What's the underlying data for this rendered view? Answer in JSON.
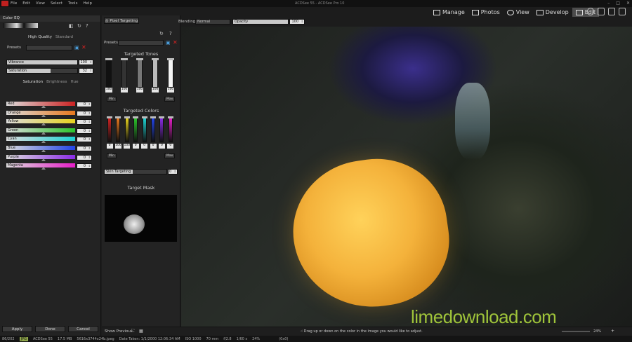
{
  "app": {
    "window_title": "ACDSee 55 - ACDSee Pro 10"
  },
  "menu": [
    "File",
    "Edit",
    "View",
    "Select",
    "Tools",
    "Help"
  ],
  "modes": [
    {
      "label": "Manage",
      "icon": "grid-icon"
    },
    {
      "label": "Photos",
      "icon": "photos-icon"
    },
    {
      "label": "View",
      "icon": "eye-icon"
    },
    {
      "label": "Develop",
      "icon": "develop-icon"
    },
    {
      "label": "Edit",
      "icon": "edit-icon",
      "active": true
    }
  ],
  "color_eq": {
    "title": "Color EQ",
    "quality_tabs": [
      "High Quality",
      "Standard"
    ],
    "presets_label": "Presets",
    "vibrance": {
      "label": "Vibrance",
      "value": "100",
      "fraction": 1.0
    },
    "saturation": {
      "label": "Saturation",
      "value": "32",
      "fraction": 0.62
    },
    "tabs": [
      "Saturation",
      "Brightness",
      "Hue"
    ],
    "colors": [
      {
        "label": "Red",
        "value": "0",
        "grad": "linear-gradient(90deg,#ddd,#c22)"
      },
      {
        "label": "Orange",
        "value": "0",
        "grad": "linear-gradient(90deg,#ddd,#e6781e)"
      },
      {
        "label": "Yellow",
        "value": "0",
        "grad": "linear-gradient(90deg,#ddd,#e6d21e)"
      },
      {
        "label": "Green",
        "value": "0",
        "grad": "linear-gradient(90deg,#ddd,#2bc32b)"
      },
      {
        "label": "Cyan",
        "value": "0",
        "grad": "linear-gradient(90deg,#ddd,#1ed2d2)"
      },
      {
        "label": "Blue",
        "value": "0",
        "grad": "linear-gradient(90deg,#ddd,#2244e6)"
      },
      {
        "label": "Purple",
        "value": "0",
        "grad": "linear-gradient(90deg,#ddd,#8a2be6)"
      },
      {
        "label": "Magenta",
        "value": "0",
        "grad": "linear-gradient(90deg,#ddd,#e61ec8)"
      }
    ],
    "apply_label": "Apply",
    "done_label": "Done",
    "cancel_label": "Cancel"
  },
  "pixel_targeting": {
    "button_label": "Pixel Targeting",
    "blending_label": "Blending:",
    "blending_value": "Normal",
    "opacity_label": "Opacity",
    "opacity_value": "100",
    "presets_label": "Presets",
    "targeted_tones_title": "Targeted Tones",
    "tones": [
      {
        "value": "100",
        "color": "#111"
      },
      {
        "value": "100",
        "color": "#333"
      },
      {
        "value": "100",
        "color": "#777"
      },
      {
        "value": "100",
        "color": "#bbb"
      },
      {
        "value": "100",
        "color": "#f4f4f4"
      }
    ],
    "tones_min": "Min",
    "tones_max": "Max",
    "targeted_colors_title": "Targeted Colors",
    "colors": [
      {
        "value": "0",
        "color": "#c22"
      },
      {
        "value": "100",
        "color": "#e6781e"
      },
      {
        "value": "100",
        "color": "#e6d21e"
      },
      {
        "value": "0",
        "color": "#2bc32b"
      },
      {
        "value": "0",
        "color": "#1ed2d2"
      },
      {
        "value": "0",
        "color": "#2244e6"
      },
      {
        "value": "0",
        "color": "#8a2be6"
      },
      {
        "value": "0",
        "color": "#e61ec8"
      }
    ],
    "colors_min": "Min",
    "colors_max": "Max",
    "skin_label": "Skin Targeting",
    "skin_value": "0",
    "target_mask_title": "Target Mask"
  },
  "bottom": {
    "show_previous": "Show Previous",
    "hint": "Drag up or down on the color in the image you would like to adjust.",
    "zoom": "24%"
  },
  "status": {
    "count": "86/202",
    "format": "JPG",
    "name": "ACDSee 55",
    "size": "17.5 MB",
    "file": "5616x3744x24b.jpeg",
    "date": "Date Taken: 1/1/2000 12:06:34 AM",
    "iso": "ISO 1000",
    "focal": "70 mm",
    "aperture": "f/2.8",
    "shutter": "1/60 s",
    "zoom": "24%",
    "coords": "(0x0)"
  },
  "watermark": "limedownload.com"
}
